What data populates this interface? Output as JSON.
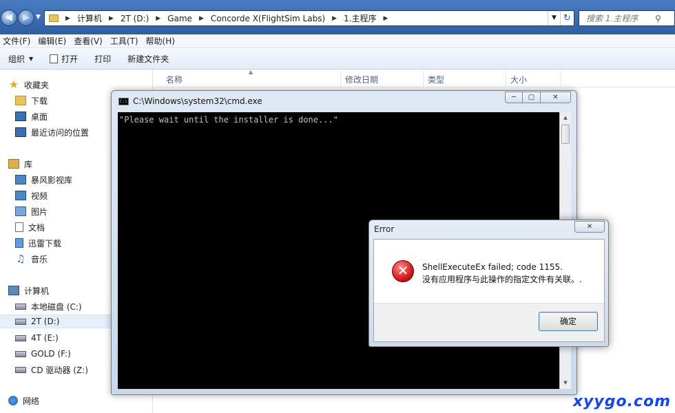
{
  "address_bar": {
    "breadcrumbs": [
      "计算机",
      "2T (D:)",
      "Game",
      "Concorde X(FlightSim Labs)",
      "1.主程序"
    ],
    "search_placeholder": "搜索 1.主程序"
  },
  "menubar": {
    "items": [
      "文件(F)",
      "编辑(E)",
      "查看(V)",
      "工具(T)",
      "帮助(H)"
    ]
  },
  "toolbar": {
    "organize": "组织",
    "open": "打开",
    "print": "打印",
    "new_folder": "新建文件夹"
  },
  "sidebar": {
    "favorites": {
      "label": "收藏夹",
      "items": [
        "下载",
        "桌面",
        "最近访问的位置"
      ]
    },
    "libraries": {
      "label": "库",
      "items": [
        "暴风影视库",
        "视频",
        "图片",
        "文档",
        "迅雷下载",
        "音乐"
      ]
    },
    "computer": {
      "label": "计算机",
      "items": [
        "本地磁盘 (C:)",
        "2T (D:)",
        "4T (E:)",
        "GOLD (F:)",
        "CD 驱动器 (Z:)"
      ],
      "selected": "2T (D:)"
    },
    "network": {
      "label": "网络"
    }
  },
  "file_list": {
    "columns": [
      "名称",
      "修改日期",
      "类型",
      "大小"
    ]
  },
  "cmd_window": {
    "title": "C:\\Windows\\system32\\cmd.exe",
    "output": "\"Please wait until the installer is done...\""
  },
  "error_dialog": {
    "title": "Error",
    "message_line1": "ShellExecuteEx failed; code 1155.",
    "message_line2": "没有应用程序与此操作的指定文件有关联。.",
    "ok_label": "确定"
  },
  "watermark": "xyygo.com"
}
